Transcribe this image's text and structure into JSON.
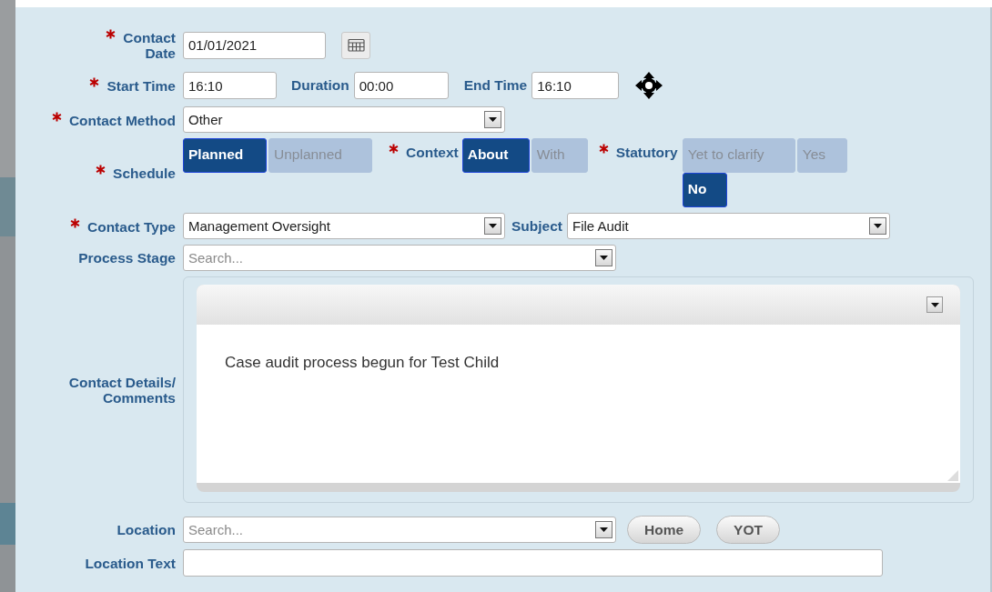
{
  "form": {
    "contact_date": {
      "label": "Contact Date",
      "required": true,
      "value": "01/01/2021"
    },
    "start_time": {
      "label": "Start Time",
      "required": true,
      "value": "16:10"
    },
    "duration": {
      "label": "Duration",
      "value": "00:00"
    },
    "end_time": {
      "label": "End Time",
      "value": "16:10"
    },
    "contact_method": {
      "label": "Contact Method",
      "required": true,
      "value": "Other"
    },
    "schedule": {
      "label": "Schedule",
      "required": true,
      "options": [
        {
          "label": "Planned",
          "selected": true
        },
        {
          "label": "Unplanned",
          "selected": false
        }
      ]
    },
    "context": {
      "label": "Context",
      "required": true,
      "options": [
        {
          "label": "About",
          "selected": true
        },
        {
          "label": "With",
          "selected": false
        }
      ]
    },
    "statutory": {
      "label": "Statutory",
      "required": true,
      "options": [
        {
          "label": "Yet to clarify",
          "selected": false
        },
        {
          "label": "Yes",
          "selected": false
        },
        {
          "label": "No",
          "selected": true
        }
      ]
    },
    "contact_type": {
      "label": "Contact Type",
      "required": true,
      "value": "Management Oversight"
    },
    "subject": {
      "label": "Subject",
      "value": "File Audit"
    },
    "process_stage": {
      "label": "Process Stage",
      "placeholder": "Search..."
    },
    "contact_details": {
      "label": "Contact Details/ Comments",
      "text": "Case audit process begun for Test Child"
    },
    "location": {
      "label": "Location",
      "placeholder": "Search...",
      "buttons": [
        "Home",
        "YOT"
      ]
    },
    "location_text": {
      "label": "Location Text"
    }
  }
}
